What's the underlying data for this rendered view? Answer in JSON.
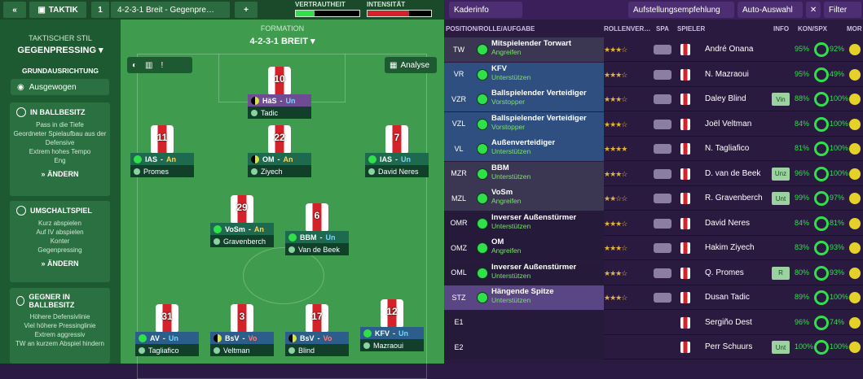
{
  "topbar": {
    "back": "«",
    "taktik": "TAKTIK",
    "slot": "1",
    "formation_dropdown": "4-2-3-1 Breit - Gegenpre…",
    "add": "+",
    "vertrautheit": "VERTRAUTHEIT",
    "intensitaet": "INTENSITÄT"
  },
  "toolbar": {
    "kaderinfo": "Kaderinfo",
    "aufstellung": "Aufstellungsempfehlung",
    "auto": "Auto-Auswahl",
    "filter": "Filter"
  },
  "left": {
    "stil_label": "TAKTISCHER STIL",
    "stil": "GEGENPRESSING",
    "grund_label": "GRUNDAUSRICHTUNG",
    "grund": "Ausgewogen",
    "sections": [
      {
        "title": "IN BALLBESITZ",
        "lines": [
          "Pass in die Tiefe",
          "Geordneter Spielaufbau aus der Defensive",
          "Extrem hohes Tempo",
          "Eng"
        ],
        "btn": "ÄNDERN"
      },
      {
        "title": "UMSCHALTSPIEL",
        "lines": [
          "Kurz abspielen",
          "Auf IV abspielen",
          "Konter",
          "Gegenpressing"
        ],
        "btn": "ÄNDERN"
      },
      {
        "title": "GEGNER IN BALLBESITZ",
        "lines": [
          "Höhere Defensivlinie",
          "Viel höhere Pressinglinie",
          "Extrem aggressiv",
          "TW an kurzem Abspiel hindern"
        ]
      }
    ]
  },
  "pitch": {
    "formation_label": "FORMATION",
    "formation": "4-2-3-1 BREIT",
    "analyse": "Analyse"
  },
  "players": [
    {
      "num": "10",
      "role": "HäS",
      "duty": "Un",
      "name": "Tadic"
    },
    {
      "num": "11",
      "role": "IAS",
      "duty": "An",
      "name": "Promes"
    },
    {
      "num": "22",
      "role": "OM",
      "duty": "An",
      "name": "Ziyech"
    },
    {
      "num": "7",
      "role": "IAS",
      "duty": "Un",
      "name": "David Neres"
    },
    {
      "num": "29",
      "role": "VoSm",
      "duty": "An",
      "name": "Gravenberch"
    },
    {
      "num": "6",
      "role": "BBM",
      "duty": "Un",
      "name": "Van de Beek"
    },
    {
      "num": "31",
      "role": "AV",
      "duty": "Un",
      "name": "Tagliafico"
    },
    {
      "num": "3",
      "role": "BsV",
      "duty": "Vo",
      "name": "Veltman"
    },
    {
      "num": "17",
      "role": "BsV",
      "duty": "Vo",
      "name": "Blind"
    },
    {
      "num": "12",
      "role": "KFV",
      "duty": "Un",
      "name": "Mazraoui"
    }
  ],
  "table": {
    "headers": [
      "POSITION/ROLLE/AUFGABE",
      "ROLLENVER…",
      "SPA",
      "SPIELER",
      "INFO",
      "KON/SPX",
      "MOR"
    ],
    "rows": [
      {
        "pos": "TW",
        "role": "Mitspielender Torwart",
        "duty": "Angreifen",
        "stars": "★★★☆",
        "player": "André Onana",
        "info": "",
        "kon": "95%",
        "spx": "92%"
      },
      {
        "pos": "VR",
        "role": "KFV",
        "duty": "Unterstützen",
        "stars": "★★★☆",
        "player": "N. Mazraoui",
        "info": "",
        "kon": "95%",
        "spx": "49%"
      },
      {
        "pos": "VZR",
        "role": "Ballspielender Verteidiger",
        "duty": "Vorstopper",
        "stars": "★★★☆",
        "player": "Daley Blind",
        "info": "Vin",
        "kon": "88%",
        "spx": "100%"
      },
      {
        "pos": "VZL",
        "role": "Ballspielender Verteidiger",
        "duty": "Vorstopper",
        "stars": "★★★☆",
        "player": "Joël Veltman",
        "info": "",
        "kon": "84%",
        "spx": "100%"
      },
      {
        "pos": "VL",
        "role": "Außenverteidiger",
        "duty": "Unterstützen",
        "stars": "★★★★",
        "player": "N. Tagliafico",
        "info": "",
        "kon": "81%",
        "spx": "100%"
      },
      {
        "pos": "MZR",
        "role": "BBM",
        "duty": "Unterstützen",
        "stars": "★★★☆",
        "player": "D. van de Beek",
        "info": "Unz",
        "kon": "96%",
        "spx": "100%"
      },
      {
        "pos": "MZL",
        "role": "VoSm",
        "duty": "Angreifen",
        "stars": "★★☆☆",
        "player": "R. Gravenberch",
        "info": "Unt",
        "kon": "99%",
        "spx": "97%"
      },
      {
        "pos": "OMR",
        "role": "Inverser Außenstürmer",
        "duty": "Unterstützen",
        "stars": "★★★☆",
        "player": "David Neres",
        "info": "",
        "kon": "84%",
        "spx": "81%"
      },
      {
        "pos": "OMZ",
        "role": "OM",
        "duty": "Angreifen",
        "stars": "★★★☆",
        "player": "Hakim Ziyech",
        "info": "",
        "kon": "83%",
        "spx": "93%"
      },
      {
        "pos": "OML",
        "role": "Inverser Außenstürmer",
        "duty": "Unterstützen",
        "stars": "★★★☆",
        "player": "Q. Promes",
        "info": "R",
        "kon": "80%",
        "spx": "93%"
      },
      {
        "pos": "STZ",
        "role": "Hängende Spitze",
        "duty": "Unterstützen",
        "stars": "★★★☆",
        "player": "Dusan Tadic",
        "info": "",
        "kon": "89%",
        "spx": "100%"
      },
      {
        "pos": "E1",
        "role": "",
        "duty": "",
        "stars": "",
        "player": "Sergiño Dest",
        "info": "",
        "kon": "96%",
        "spx": "74%"
      },
      {
        "pos": "E2",
        "role": "",
        "duty": "",
        "stars": "",
        "player": "Perr Schuurs",
        "info": "Unt",
        "kon": "100%",
        "spx": "100%"
      }
    ]
  }
}
